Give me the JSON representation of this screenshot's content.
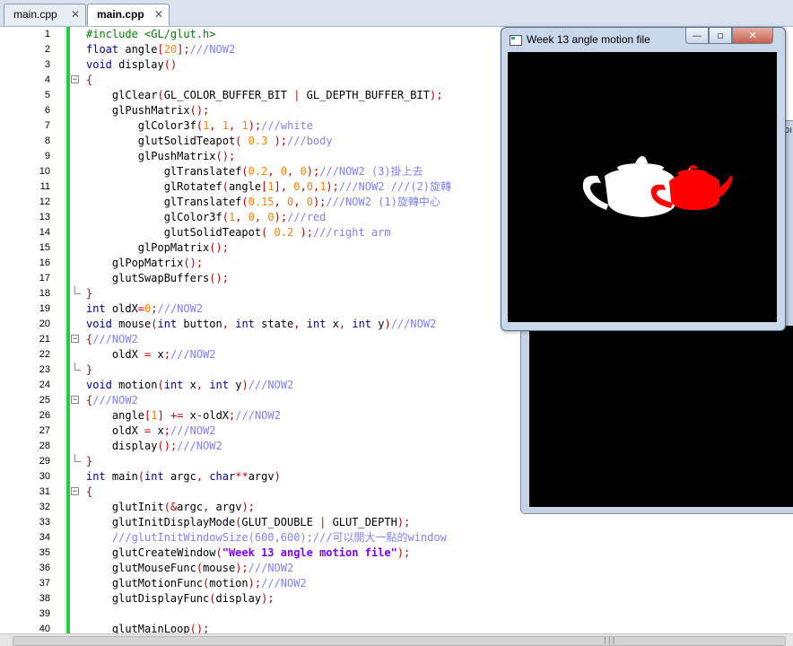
{
  "tabs": [
    {
      "label": "main.cpp",
      "active": false
    },
    {
      "label": "main.cpp",
      "active": true
    }
  ],
  "tab_close_glyph": "✕",
  "gl_window": {
    "title": "Week 13 angle motion file",
    "min_glyph": "—",
    "max_glyph": "▫",
    "close_glyph": "✕",
    "background_color": "#000000",
    "teapot_colors": {
      "body": "#ffffff",
      "arm": "#ff0000"
    }
  },
  "gl_window_behind": {
    "title_fragment": "ƅı",
    "background_color": "#000000"
  },
  "code_lines": [
    {
      "n": "1",
      "text": "#include <GL/glut.h>"
    },
    {
      "n": "2",
      "text": "float angle[20];///NOW2"
    },
    {
      "n": "3",
      "text": "void display()"
    },
    {
      "n": "4",
      "text": "{"
    },
    {
      "n": "5",
      "text": "    glClear(GL_COLOR_BUFFER_BIT | GL_DEPTH_BUFFER_BIT);"
    },
    {
      "n": "6",
      "text": "    glPushMatrix();"
    },
    {
      "n": "7",
      "text": "        glColor3f(1, 1, 1);///white"
    },
    {
      "n": "8",
      "text": "        glutSolidTeapot( 0.3 );///body"
    },
    {
      "n": "9",
      "text": "        glPushMatrix();"
    },
    {
      "n": "10",
      "text": "            glTranslatef(0.2, 0, 0);///NOW2 (3)掛上去"
    },
    {
      "n": "11",
      "text": "            glRotatef(angle[1], 0,0,1);///NOW2 ///(2)旋轉"
    },
    {
      "n": "12",
      "text": "            glTranslatef(0.15, 0, 0);///NOW2 (1)旋轉中心"
    },
    {
      "n": "13",
      "text": "            glColor3f(1, 0, 0);///red"
    },
    {
      "n": "14",
      "text": "            glutSolidTeapot( 0.2 );///right arm"
    },
    {
      "n": "15",
      "text": "        glPopMatrix();"
    },
    {
      "n": "16",
      "text": "    glPopMatrix();"
    },
    {
      "n": "17",
      "text": "    glutSwapBuffers();"
    },
    {
      "n": "18",
      "text": "}"
    },
    {
      "n": "19",
      "text": "int oldX=0;///NOW2"
    },
    {
      "n": "20",
      "text": "void mouse(int button, int state, int x, int y)///NOW2"
    },
    {
      "n": "21",
      "text": "{///NOW2"
    },
    {
      "n": "22",
      "text": "    oldX = x;///NOW2"
    },
    {
      "n": "23",
      "text": "}"
    },
    {
      "n": "24",
      "text": "void motion(int x, int y)///NOW2"
    },
    {
      "n": "25",
      "text": "{///NOW2"
    },
    {
      "n": "26",
      "text": "    angle[1] += x-oldX;///NOW2"
    },
    {
      "n": "27",
      "text": "    oldX = x;///NOW2"
    },
    {
      "n": "28",
      "text": "    display();///NOW2"
    },
    {
      "n": "29",
      "text": "}"
    },
    {
      "n": "30",
      "text": "int main(int argc, char**argv)"
    },
    {
      "n": "31",
      "text": "{"
    },
    {
      "n": "32",
      "text": "    glutInit(&argc, argv);"
    },
    {
      "n": "33",
      "text": "    glutInitDisplayMode(GLUT_DOUBLE | GLUT_DEPTH);"
    },
    {
      "n": "34",
      "text": "    ///glutInitWindowSize(600,600);///可以開大一點的window"
    },
    {
      "n": "35",
      "text": "    glutCreateWindow(\"Week 13 angle motion file\");"
    },
    {
      "n": "36",
      "text": "    glutMouseFunc(mouse);///NOW2"
    },
    {
      "n": "37",
      "text": "    glutMotionFunc(motion);///NOW2"
    },
    {
      "n": "38",
      "text": "    glutDisplayFunc(display);"
    },
    {
      "n": "39",
      "text": ""
    },
    {
      "n": "40",
      "text": "    glutMainLoop();"
    }
  ],
  "scrollbar_grip": "|||",
  "colors": {
    "change_bar": "#22cc44",
    "keyword": "#0000a0",
    "preprocessor": "#008000",
    "operator": "#c00000",
    "comment": "#8080ff",
    "number": "#ff8000",
    "string": "#8000ff"
  }
}
